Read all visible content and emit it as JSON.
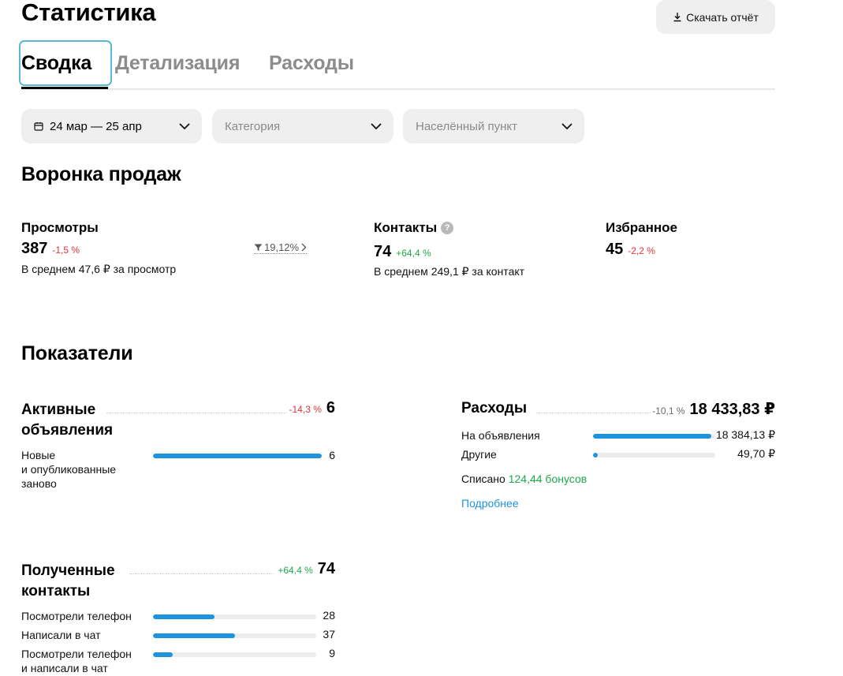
{
  "header": {
    "title": "Статистика",
    "download_label": "Скачать отчёт"
  },
  "tabs": [
    {
      "label": "Сводка",
      "active": true
    },
    {
      "label": "Детализация",
      "active": false
    },
    {
      "label": "Расходы",
      "active": false
    }
  ],
  "filters": {
    "date": "24 мар — 25 апр",
    "category_placeholder": "Категория",
    "city_placeholder": "Населённый пункт"
  },
  "funnel": {
    "heading": "Воронка продаж",
    "views": {
      "title": "Просмотры",
      "value": "387",
      "delta": "-1,5 %",
      "avg": "В среднем 47,6 ₽ за просмотр",
      "conversion": "19,12%"
    },
    "contacts": {
      "title": "Контакты",
      "value": "74",
      "delta": "+64,4 %",
      "avg": "В среднем 249,1 ₽ за контакт"
    },
    "favorites": {
      "title": "Избранное",
      "value": "45",
      "delta": "-2,2 %"
    }
  },
  "indicators": {
    "heading": "Показатели",
    "active_ads": {
      "title_line1": "Активные",
      "title_line2": "объявления",
      "delta": "-14,3 %",
      "value": "6",
      "rows": [
        {
          "label_line1": "Новые",
          "label_line2": "и опубликованные",
          "label_line3": "заново",
          "value": "6",
          "fraction": 1.0
        }
      ]
    },
    "expenses": {
      "title": "Расходы",
      "delta": "-10,1 %",
      "value": "18 433,83 ₽",
      "rows": [
        {
          "label": "На объявления",
          "value": "18 384,13 ₽",
          "fraction": 0.97
        },
        {
          "label": "Другие",
          "value": "49,70 ₽",
          "fraction": 0.04
        }
      ],
      "bonus_prefix": "Списано",
      "bonus_value": "124,44 бонусов",
      "more_link": "Подробнее"
    },
    "contacts": {
      "title_line1": "Полученные",
      "title_line2": "контакты",
      "delta": "+64,4 %",
      "value": "74",
      "rows": [
        {
          "label": "Посмотрели телефон",
          "value": "28",
          "fraction": 0.378
        },
        {
          "label": "Написали в чат",
          "value": "37",
          "fraction": 0.5
        },
        {
          "label_line1": "Посмотрели телефон",
          "label_line2": "и написали в чат",
          "value": "9",
          "fraction": 0.12
        }
      ]
    }
  },
  "colors": {
    "accent": "#1e93de",
    "negative": "#e6323c",
    "positive": "#1fa84a",
    "focus": "#5bb7d6"
  }
}
